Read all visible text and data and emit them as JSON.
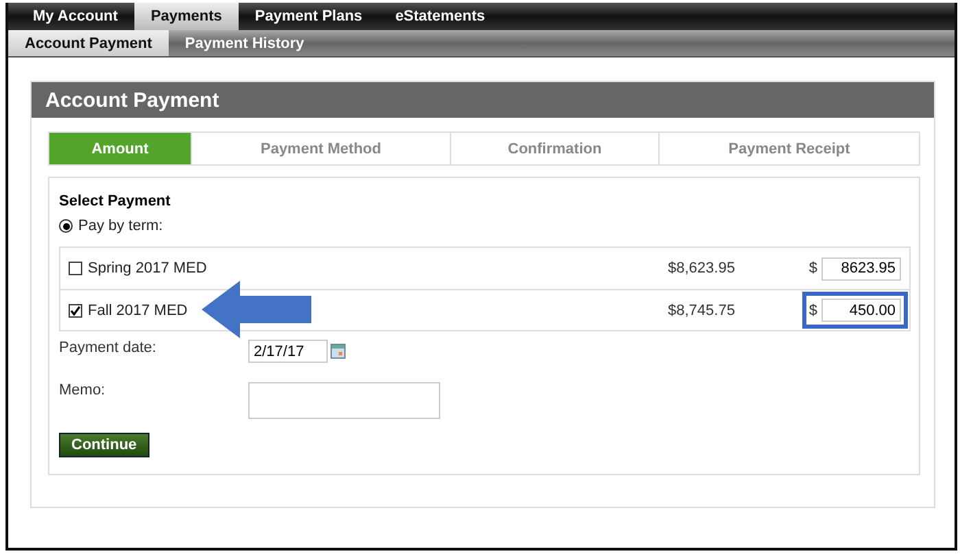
{
  "main_nav": [
    {
      "label": "My Account",
      "selected": false
    },
    {
      "label": "Payments",
      "selected": true
    },
    {
      "label": "Payment Plans",
      "selected": false
    },
    {
      "label": "eStatements",
      "selected": false
    }
  ],
  "sub_nav": [
    {
      "label": "Account Payment",
      "selected": true
    },
    {
      "label": "Payment History",
      "selected": false
    }
  ],
  "panel_title": "Account Payment",
  "steps": [
    {
      "label": "Amount",
      "selected": true
    },
    {
      "label": "Payment Method",
      "selected": false
    },
    {
      "label": "Confirmation",
      "selected": false
    },
    {
      "label": "Payment Receipt",
      "selected": false
    }
  ],
  "section_title": "Select Payment",
  "pay_option": {
    "label": "Pay by term:",
    "selected": true
  },
  "terms": [
    {
      "name": "Spring 2017 MED",
      "checked": false,
      "balance": "$8,623.95",
      "currency": "$",
      "amount": "8623.95",
      "highlighted": false,
      "pointed": false
    },
    {
      "name": "Fall 2017 MED",
      "checked": true,
      "balance": "$8,745.75",
      "currency": "$",
      "amount": "450.00",
      "highlighted": true,
      "pointed": true
    }
  ],
  "payment_date": {
    "label": "Payment date:",
    "value": "2/17/17"
  },
  "memo": {
    "label": "Memo:"
  },
  "continue_button": "Continue"
}
